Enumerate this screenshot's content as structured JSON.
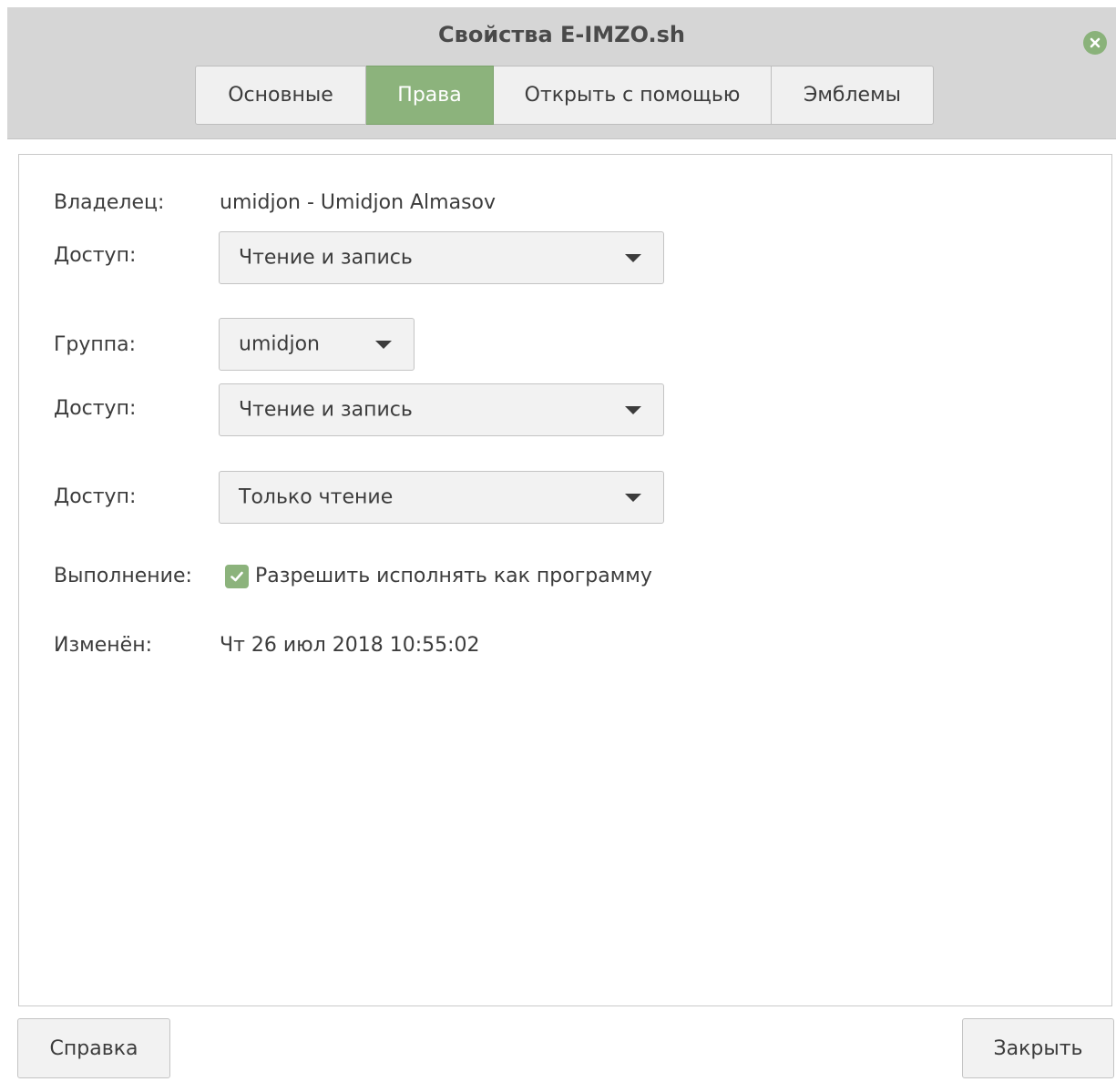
{
  "window": {
    "title": "Свойства E-IMZO.sh"
  },
  "tabs": [
    {
      "label": "Основные",
      "active": false
    },
    {
      "label": "Права",
      "active": true
    },
    {
      "label": "Открыть с помощью",
      "active": false
    },
    {
      "label": "Эмблемы",
      "active": false
    }
  ],
  "permissions": {
    "owner_label": "Владелец:",
    "owner_value": "umidjon - Umidjon Almasov",
    "owner_access_label": "Доступ:",
    "owner_access_value": "Чтение и запись",
    "group_label": "Группа:",
    "group_value": "umidjon",
    "group_access_label": "Доступ:",
    "group_access_value": "Чтение и запись",
    "others_access_label": "Доступ:",
    "others_access_value": "Только чтение",
    "execute_label": "Выполнение:",
    "execute_checkbox_label": "Разрешить исполнять как программу",
    "execute_checked": true,
    "modified_label": "Изменён:",
    "modified_value": "Чт 26 июл 2018 10:55:02"
  },
  "footer": {
    "help_label": "Справка",
    "close_label": "Закрыть"
  },
  "colors": {
    "accent": "#8cb37c",
    "header_bg": "#d6d6d6"
  },
  "icons": {
    "close": "close-icon",
    "checkbox": "checkmark-icon",
    "dropdown": "chevron-down-icon"
  }
}
